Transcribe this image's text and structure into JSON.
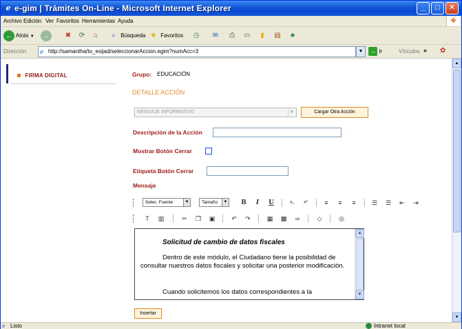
{
  "window": {
    "title": "e-gim | Trámites On-Line - Microsoft Internet Explorer",
    "controls": {
      "minimize": "_",
      "maximize": "□",
      "close": "✕"
    }
  },
  "menu": [
    "Archivo",
    "Edición",
    "Ver",
    "Favoritos",
    "Herramientas",
    "Ayuda"
  ],
  "toolbar": {
    "back_label": "Atrás",
    "search_label": "Búsqueda",
    "favorites_label": "Favoritos"
  },
  "address": {
    "label": "Dirección",
    "url": "http://samantha/to_esijad/seleccionarAccion.egim?numAcc=3",
    "go_label": "Ir",
    "links_label": "Vínculos",
    "links_chevron": "»"
  },
  "nav": {
    "firma_digital": "FIRMA DIGITAL"
  },
  "form": {
    "grupo_label": "Grupo:",
    "grupo_value": "EDUCACIÓN",
    "detalle_title": "DETALLE ACCIÓN",
    "accion_selected": "MENSAJE INFORMATIVO",
    "cargar_button": "Cargar Otra Acción",
    "descripcion_label": "Descripción de la Acción",
    "mostrar_label": "Mostrar Botón Cerrar",
    "etiqueta_label": "Etiqueta Botón Cerrar",
    "mensaje_label": "Mensaje",
    "insertar_button": "Insertar"
  },
  "editor": {
    "font_select": "Selec. Fuente",
    "size_select": "Tamaño",
    "title": "Solicitud de cambio de datos fiscales",
    "para1": "Dentro de este módulo, el Ciudadano tiene la posibilidad de consultar nuestros datos fiscales y solicitar una posterior modificación.",
    "para2": "Cuando solicitemos los datos correspondientes a la"
  },
  "status": {
    "text": "Listo",
    "zone": "Intranet local"
  },
  "colors": {
    "accent_orange": "#e0892a",
    "label_red": "#9c1a1a",
    "xp_blue": "#0a49d0"
  }
}
